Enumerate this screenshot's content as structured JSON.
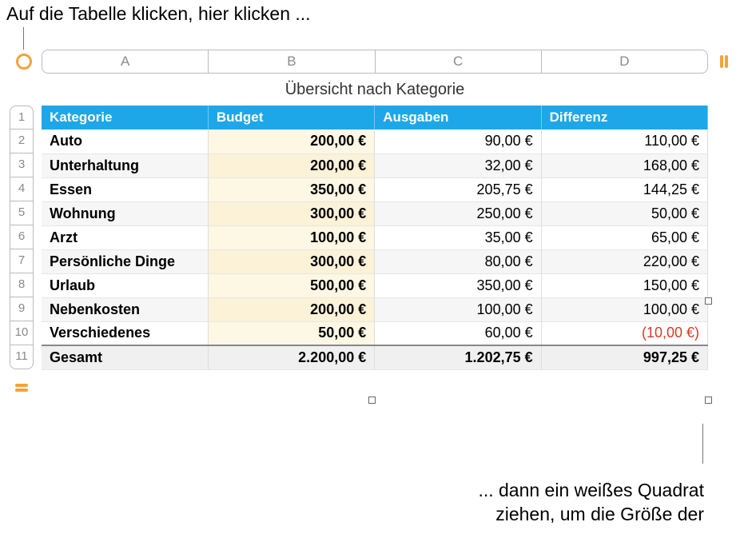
{
  "annotations": {
    "top": "Auf die Tabelle klicken, hier klicken ...",
    "bottom": "... dann ein weißes Quadrat\nziehen, um die Größe der"
  },
  "columnLetters": [
    "A",
    "B",
    "C",
    "D"
  ],
  "rowNumbers": [
    "1",
    "2",
    "3",
    "4",
    "5",
    "6",
    "7",
    "8",
    "9",
    "10",
    "11"
  ],
  "title": "Übersicht nach Kategorie",
  "headers": {
    "cat": "Kategorie",
    "bud": "Budget",
    "exp": "Ausgaben",
    "dif": "Differenz"
  },
  "rows": [
    {
      "cat": "Auto",
      "bud": "200,00 €",
      "exp": "90,00 €",
      "dif": "110,00 €"
    },
    {
      "cat": "Unterhaltung",
      "bud": "200,00 €",
      "exp": "32,00 €",
      "dif": "168,00 €"
    },
    {
      "cat": "Essen",
      "bud": "350,00 €",
      "exp": "205,75 €",
      "dif": "144,25 €"
    },
    {
      "cat": "Wohnung",
      "bud": "300,00 €",
      "exp": "250,00 €",
      "dif": "50,00 €"
    },
    {
      "cat": "Arzt",
      "bud": "100,00 €",
      "exp": "35,00 €",
      "dif": "65,00 €"
    },
    {
      "cat": "Persönliche Dinge",
      "bud": "300,00 €",
      "exp": "80,00 €",
      "dif": "220,00 €"
    },
    {
      "cat": "Urlaub",
      "bud": "500,00 €",
      "exp": "350,00 €",
      "dif": "150,00 €"
    },
    {
      "cat": "Nebenkosten",
      "bud": "200,00 €",
      "exp": "100,00 €",
      "dif": "100,00 €"
    },
    {
      "cat": "Verschiedenes",
      "bud": "50,00 €",
      "exp": "60,00 €",
      "dif": "(10,00 €)",
      "neg": true
    }
  ],
  "total": {
    "cat": "Gesamt",
    "bud": "2.200,00 €",
    "exp": "1.202,75 €",
    "dif": "997,25 €"
  }
}
